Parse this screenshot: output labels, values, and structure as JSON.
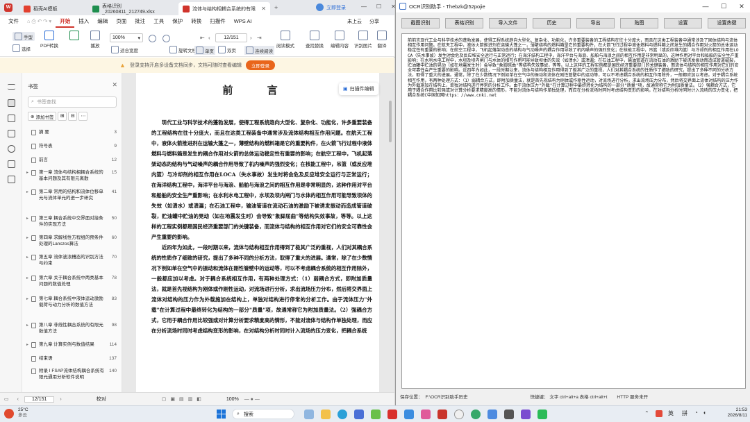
{
  "wps": {
    "tabs": [
      {
        "label": "稻壳AI模板"
      },
      {
        "label": "表格识别_20260811_212749.xlsx"
      },
      {
        "label": "流体与结构相耦合系统的有限..."
      }
    ],
    "login_label": "立即登录",
    "menu": [
      "文件",
      "开始",
      "插入",
      "编辑",
      "页面",
      "批注",
      "工具",
      "保护",
      "转换",
      "扫描件",
      "WPS AI"
    ],
    "active_menu": "开始",
    "share_label": "分享",
    "user_label": "未上云",
    "ribbon": {
      "hand": "手型",
      "select": "选择",
      "pdf_convert": "PDF转换",
      "play": "播放",
      "zoom": "100%",
      "fit_width": "适合宽度",
      "page": "12/151",
      "rotate": "旋转文档",
      "single": "单页",
      "double": "双页",
      "continuous": "连续阅读",
      "read_mode": "阅读模式",
      "replace": "查找替换",
      "edit_content": "编辑内容",
      "ocr_text": "识别图片",
      "translate": "翻译"
    },
    "notice": {
      "text": "登录支持开启多设备文档同步，文档可随时查看编辑",
      "button": "立即登录"
    },
    "bookmarks": {
      "title": "书签",
      "search_placeholder": "书签查找",
      "add_label": "添加书签",
      "items": [
        {
          "label": "摘 要",
          "page": "3"
        },
        {
          "label": "符号表",
          "page": "9"
        },
        {
          "label": "前言",
          "page": "12"
        },
        {
          "label": "第一章 流体与结构相耦合系统的基本问题及其有限元离散",
          "page": "15"
        },
        {
          "label": "第二章 常用的结构和流体位移单元与流体单元的进一步研究",
          "page": "41"
        },
        {
          "label": "第三章 耦合系统中交界面对接条件的实现方法",
          "page": "50"
        },
        {
          "label": "第四章 求解线性方程组的预条件处理的Lanczos算法",
          "page": "60"
        },
        {
          "label": "第五章 流体波浪槽态的识别方法与约束",
          "page": "70"
        },
        {
          "label": "第六章 关于耦合系统中两类基本问题的数值处理",
          "page": "78"
        },
        {
          "label": "第七章 耦合系统中液体运动激励载荷与动力分析的数值方法",
          "page": "83"
        },
        {
          "label": "第八章 非线性耦合系统的有限元数值方法",
          "page": "98"
        },
        {
          "label": "第九章 计算实例与数值结果",
          "page": "114"
        },
        {
          "label": "结束语",
          "page": "137"
        },
        {
          "label": "附录 I FSAP流体结构耦合系统有限元通用分析软件说明",
          "page": "140"
        }
      ]
    },
    "document": {
      "title": "前 言",
      "extract_label": "扫描件编辑",
      "paragraphs": [
        "现代工业与科学技术的蓬勃发展，使得工程系统趋向大型化、复杂化、功能化，许多重要装备的工程结构在往十分庞大，而且在这类工程装备中通常涉及流体结构相互作用问题。在航天工程中，液体火箭推进剂在运输大篷之一，薄壁结构的燃料箱是它的重要构件，在火箭飞行过程中液体燃料与燃料箱是发生的耦合作用对火箭的总体运动稳定性有重要的影响；在航空工程中，飞机起落架动态的结构与气动噪声的耦合作用导致了机内噪声的强烈变化；在核能工程中，吊篮（或反应堆内篮）与冷却剂的相互作用在LOCA（失水事故）发生时将会危及反应堆安全运行与正常运行；在海洋结构工程中，海洋平台与海浪、船舶与海浪之间的相互作用是非常明显的，这种作用对平台和船舶的安全生产重影响；在水利水电工程中，水坝及坝内闸门与水体的相互作用可能导致坝体的失效（如溃水）或溃漏；在石油工程中，输油管道在流动石油的激励下被诱发振动而造成管道破裂，贮油罐中贮油的晃动（如在地震发生时）会导致\"象脚屈曲\"等结构失效事故，等等。以上这样的工程实例都是国民经济重要部门的关键装备，而流体与结构的相互作用对它们的安全可靠性会产生重要的影响。",
        "近四年为如此，一段时期以来，流体与结构相互作用得到了极其广泛的重视，人们对其耦合系统的性质作了细致的研究，提出了多种不同的分析方法，取得了重大的进展。通常，除了在少数情况下例如单在空气中的振动和流体在刚性管壁中的运动等，可以不考虑耦合系统的相互作用除外，一般都应加以考虑。对于耦合系统相互作用，有两种处理方式：（1）弱耦合方式，即附加质量法，就是首先视结构为刚体或作刚性运动，对流场进行分析，求出流场压力分布，然后将交界面上流体对结构的压力作为外载施加在结构上，单独对结构进行停常的分析工作。由于流体压力\"外载\"在计算过程中最终转化为结构的一部分\"质量\"项，故通常称它为附加质量法。（2）强耦合方式，它用于耦合作用比较强或对计算分析要求精度高的情形，不能对流体与结构作单独处理，而应在分析流场时同时考虑结构变形的影响，在对结构分析时同时计入流场的压力变化，把耦合系统"
      ]
    },
    "status": {
      "page": "12/151",
      "proof": "校对",
      "zoom": "100%"
    }
  },
  "ocr": {
    "title": "OCR识别助手 - Thebzk@52pojie",
    "toolbar": [
      "截图识别",
      "表格识别",
      "导入文件",
      "历史",
      "导出",
      "贴图",
      "设置",
      "设置热键"
    ],
    "result_text": "前前言现代工业与科学技术的蓬勃发展，使得工程系统趋向大型化、复杂化、功能化，许多重要装备的工程结构在往十分庞大，而且在这类工程装备中通常涉及了固体结构与流体相互作用问题。在航天工程中，液体火箭推进剂在运输大篷之一，薄壁结构的燃料箱是它的重要构件，在火箭飞行过程中液体燃料与燃料箱之间发生的耦合作用对火箭的总体运动稳定性有重要的影响；在航空工程中，飞机起落架动态的结构与气动噪声的耦合作用导致了机内噪声的强烈变化；在核能工程中，吊篮（或反应堆内篮）与冷却剂的相互作用在LOCA（失水事故）发生时会危及反应堆安全运行与正常运行；在海洋结构工程中，海洋平台与海浪、船舶与海浪之间的相互作用是非常明显的，这种作用对平台和船舶的安全生产重影响；在水利水电工程中，水坝及坝内闸门与水体的相互作用可能导致坝体的失效（如溃水）或溃漏；在石油工程中，输油管道在流动石油的激励下被诱发振动而造成管道破裂，贮油罐中贮油的晃动（如在地震发生时）会导致\"象脚屈曲\"等结构失效事故，等等。以上这样的工程实例都是国民经济重要部门的关键装备，而流体与结构的相互作用对它们的安全可靠性会产生重要的影响。近四年为如此，一段时期以来，流体与结构相互作用得到了极其广泛的重视，人们对其耦合系统的性质作了细致的研究，提出了多种不同的分析方法，取得了重大的进展。通常，除了在少数情况下例如单在空气中的振动和流体在刚性管壁中的运动等，可以不考虑耦合系统的相互作用除外，一般都应加以考虑。对于耦合系统相互作用，有两种处理方式：（1）弱耦合方式，即附加质量法，就是首先视结构为刚体或作刚性运动，对流场进行分析，求出流场压力分布，然后将交界面上流体对结构的压力作为外载施加在结构上，单独对结构进行停常的分析工作。由于流体压力\"外载\"在计算过程中最终转化为结构的一部分\"质量\"项，故通常称它为附加质量法。（2）强耦合方式，它用于耦合作用比较强或对计算分析要求精度高的情形，不能对流体与结构作单独处理，而应在分析流场时同时考虑结构变形的影响，在对结构分析时同时计入流场的压力变化，把耦合系统C中国知网https：//www.cnki.net",
    "status_left": "保存位置：",
    "status_path": "F:\\OCR识别助手历史",
    "status_hotkeys": "快捷键： 文字 ctrl+alt+a   表格 ctrl+alt+t",
    "status_right": "HTTP 服务未开"
  },
  "taskbar": {
    "weather_temp": "25°C",
    "weather_desc": "多云",
    "search_label": "搜索",
    "ime_label": "英",
    "ime2_label": "拼",
    "time": "21:53",
    "date": "2026/8/11"
  },
  "colors": {
    "wps_red": "#d0342c",
    "notice_orange": "#e9651b",
    "taskbar_bg": "#e8edf3"
  }
}
